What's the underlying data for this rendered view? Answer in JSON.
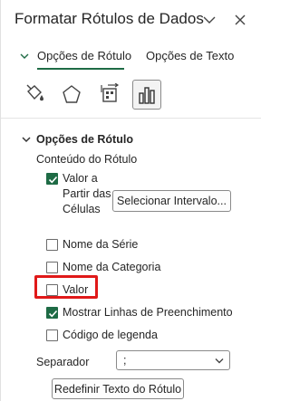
{
  "panel": {
    "title": "Formatar Rótulos de Dados",
    "collapse_icon": "chevron-down-icon",
    "close_icon": "close-icon"
  },
  "tabs": [
    {
      "label": "Opções de Rótulo",
      "active": true
    },
    {
      "label": "Opções de Texto",
      "active": false
    }
  ],
  "category_icons": [
    "fill-line-icon",
    "effects-pentagon-icon",
    "size-properties-icon",
    "label-options-bar-chart-icon"
  ],
  "section": {
    "title": "Opções de Rótulo",
    "subtitle": "Conteúdo do Rótulo"
  },
  "options": {
    "value_from_cells": {
      "label": "Valor a Partir das Células",
      "checked": true
    },
    "select_range_button": "Selecionar Intervalo...",
    "series_name": {
      "label": "Nome da Série",
      "checked": false
    },
    "category_name": {
      "label": "Nome da Categoria",
      "checked": false
    },
    "value": {
      "label": "Valor",
      "checked": false
    },
    "leader_lines": {
      "label": "Mostrar Linhas de Preenchimento",
      "checked": true
    },
    "legend_key": {
      "label": "Código de legenda",
      "checked": false
    }
  },
  "separator": {
    "label": "Separador",
    "value": ";"
  },
  "reset_button": "Redefinir Texto do Rótulo",
  "colors": {
    "accent": "#1e6b45",
    "highlight": "#e01919"
  }
}
